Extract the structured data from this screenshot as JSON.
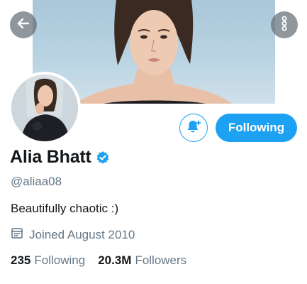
{
  "profile": {
    "display_name": "Alia Bhatt",
    "verified": true,
    "handle": "@aliaa08",
    "bio": "Beautifully chaotic :)",
    "joined": "Joined August 2010",
    "stats": [
      {
        "value": "235",
        "label": "Following"
      },
      {
        "value": "20.3M",
        "label": "Followers"
      }
    ]
  },
  "actions": {
    "follow_label": "Following"
  },
  "icons": {
    "back": "arrow-left-icon",
    "more": "more-vertical-icon",
    "notify": "bell-plus-icon",
    "verified": "verified-badge-icon",
    "calendar": "calendar-icon"
  },
  "colors": {
    "accent": "#1da1f2",
    "secondary_text": "#657786",
    "primary_text": "#14171a"
  }
}
